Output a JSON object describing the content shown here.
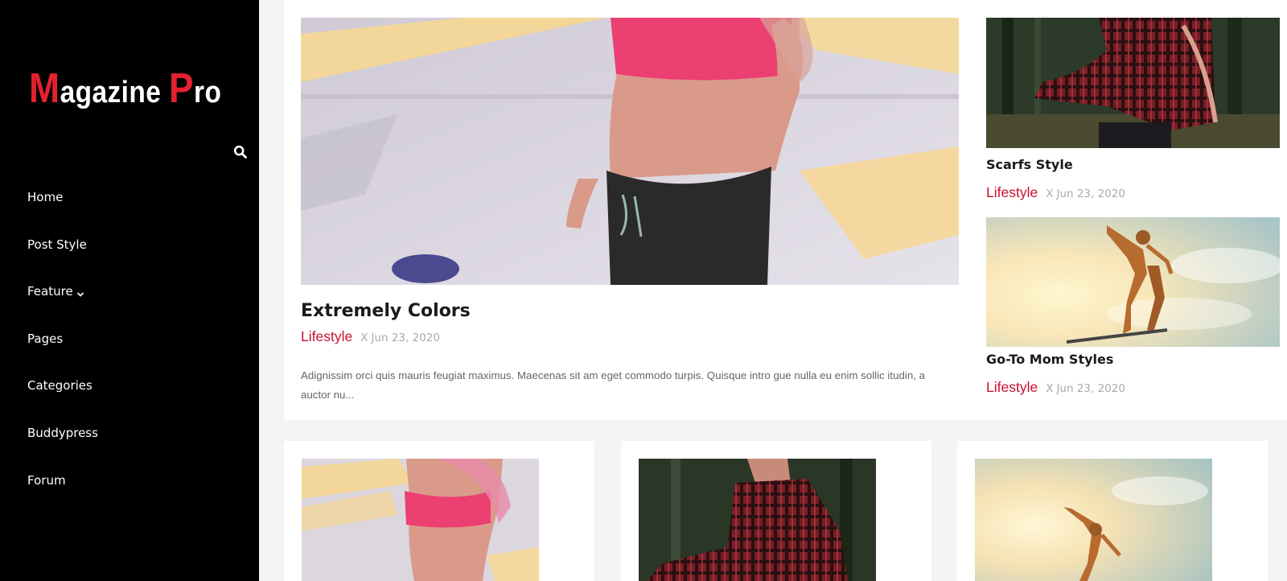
{
  "site": {
    "logo_first": "M",
    "logo_rest1": "agazine ",
    "logo_second": "P",
    "logo_rest2": "ro"
  },
  "nav": {
    "items": [
      {
        "label": "Home"
      },
      {
        "label": "Post Style"
      },
      {
        "label": "Feature"
      },
      {
        "label": "Pages"
      },
      {
        "label": "Categories"
      },
      {
        "label": "Buddypress"
      },
      {
        "label": "Forum"
      }
    ]
  },
  "featured": {
    "title": "Extremely Colors",
    "category": "Lifestyle",
    "separator": "X",
    "date": "Jun 23, 2020",
    "excerpt": "Adignissim orci quis mauris feugiat maximus. Maecenas sit am eget commodo turpis. Quisque intro gue nulla eu enim sollic itudin, a auctor nu..."
  },
  "side_posts": [
    {
      "title": "Scarfs Style",
      "category": "Lifestyle",
      "separator": "X",
      "date": "Jun 23, 2020"
    },
    {
      "title": "Go-To Mom Styles",
      "category": "Lifestyle",
      "separator": "X",
      "date": "Jun 23, 2020"
    }
  ],
  "colors": {
    "accent": "#c8102e",
    "logo_red": "#e4212f",
    "sidebar": "#000000"
  }
}
